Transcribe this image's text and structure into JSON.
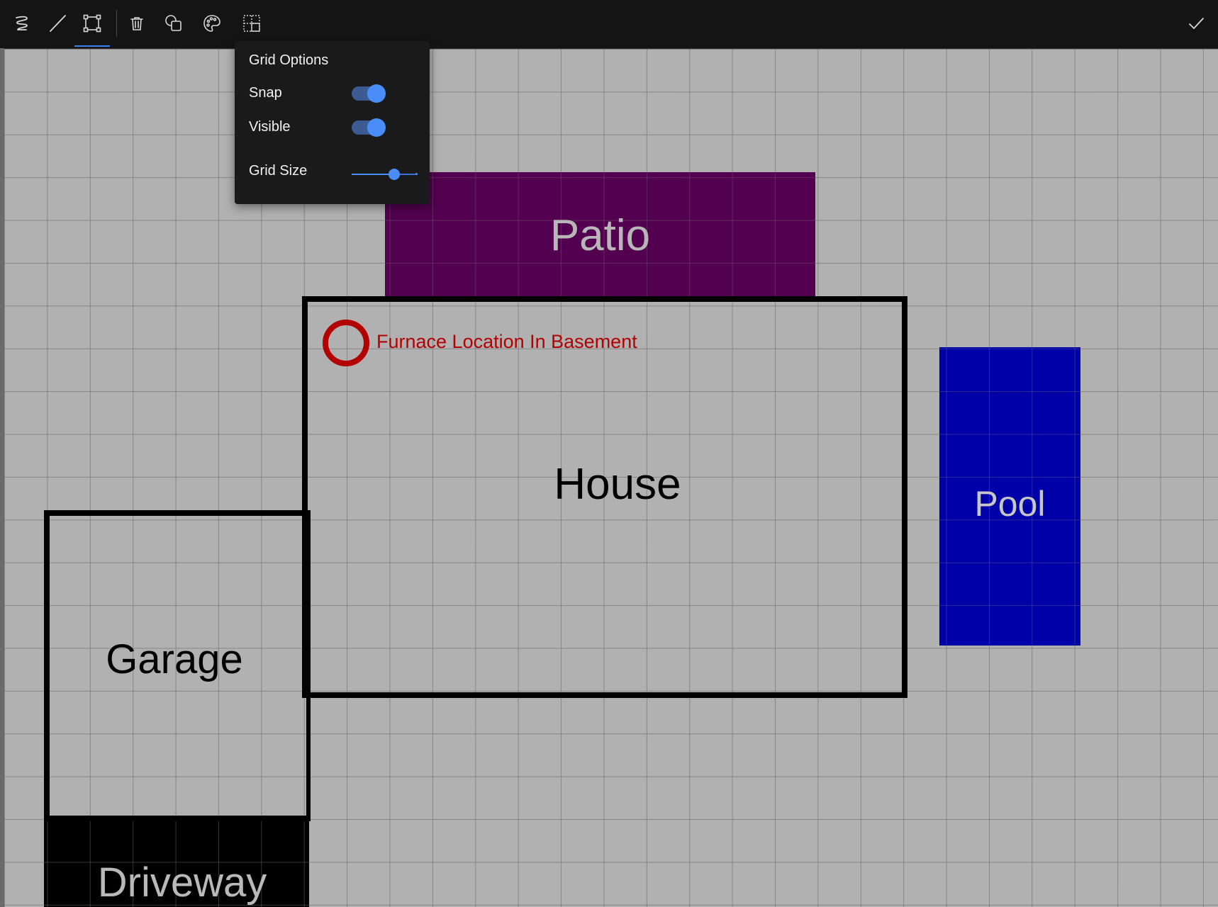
{
  "toolbar": {
    "tools": [
      {
        "icon": "freehand-icon",
        "active": false
      },
      {
        "icon": "line-icon",
        "active": false
      },
      {
        "icon": "rectangle-select-icon",
        "active": true
      },
      {
        "icon": "trash-icon",
        "active": false
      },
      {
        "icon": "shapes-icon",
        "active": false
      },
      {
        "icon": "palette-icon",
        "active": false
      },
      {
        "icon": "grid-icon",
        "active": false
      }
    ],
    "done_icon": "checkmark-icon",
    "accent_color": "#3b82f6"
  },
  "grid_options": {
    "title": "Grid Options",
    "snap_label": "Snap",
    "snap_enabled": true,
    "visible_label": "Visible",
    "visible_enabled": true,
    "grid_size_label": "Grid Size",
    "grid_size_fraction": 0.65
  },
  "canvas": {
    "shapes": {
      "patio": {
        "label": "Patio",
        "color": "#52004f"
      },
      "house": {
        "label": "House"
      },
      "pool": {
        "label": "Pool",
        "color": "#0000a9"
      },
      "garage": {
        "label": "Garage"
      },
      "driveway": {
        "label": "Driveway",
        "color": "#000000"
      }
    },
    "annotation": {
      "label": "Furnace Location In Basement",
      "color": "#b30000"
    }
  }
}
